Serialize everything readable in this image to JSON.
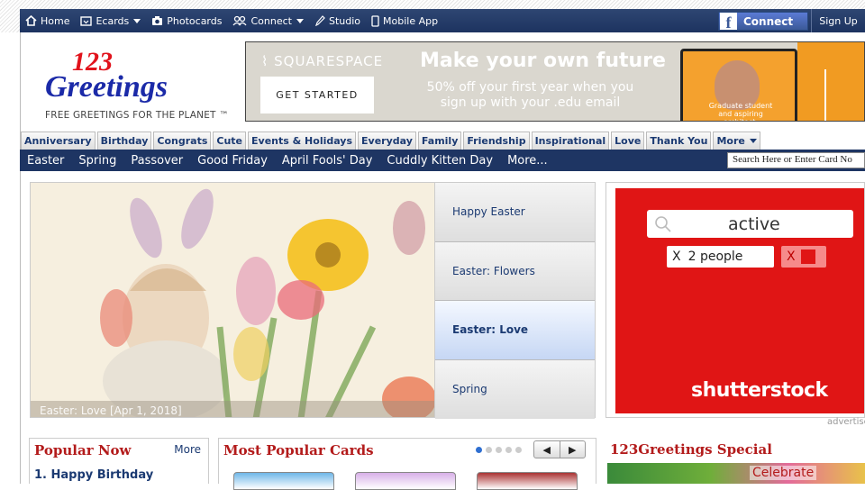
{
  "topnav": {
    "items": [
      {
        "label": "Home",
        "icon": "home-icon"
      },
      {
        "label": "Ecards",
        "icon": "ecard-icon",
        "dropdown": true
      },
      {
        "label": "Photocards",
        "icon": "camera-icon"
      },
      {
        "label": "Connect",
        "icon": "people-icon",
        "dropdown": true
      },
      {
        "label": "Studio",
        "icon": "pen-icon"
      },
      {
        "label": "Mobile App",
        "icon": "phone-icon"
      }
    ],
    "facebook_label": "Connect",
    "signup_label": "Sign Up"
  },
  "logo": {
    "number": "123",
    "word": "Greetings",
    "tagline": "FREE GREETINGS FOR THE PLANET ™"
  },
  "banner_ad": {
    "brand": "SQUARESPACE",
    "cta": "GET STARTED",
    "headline": "Make your own future",
    "subtext": "50% off your first year when you sign up with your .edu email",
    "laptop_text": "Graduate student and aspiring architect."
  },
  "categories": [
    "Anniversary",
    "Birthday",
    "Congrats",
    "Cute",
    "Events & Holidays",
    "Everyday",
    "Family",
    "Friendship",
    "Inspirational",
    "Love",
    "Thank You",
    "More"
  ],
  "subnav": [
    "Easter",
    "Spring",
    "Passover",
    "Good Friday",
    "April Fools' Day",
    "Cuddly Kitten Day",
    "More..."
  ],
  "search": {
    "placeholder": "Search Here or Enter Card No"
  },
  "slider": {
    "caption": "Easter: Love [Apr 1, 2018]",
    "items": [
      "Happy Easter",
      "Easter: Flowers",
      "Easter: Love",
      "Spring"
    ],
    "active_index": 2
  },
  "side_ad": {
    "search_term": "active",
    "filter1": "2 people",
    "filter1_x": "X",
    "filter2_x": "X",
    "brand": "shutterstock"
  },
  "advertisement_label": "advertise",
  "popular_now": {
    "title": "Popular Now",
    "more": "More",
    "first_item": "1. Happy Birthday"
  },
  "most_popular": {
    "title": "Most Popular Cards",
    "prev": "◀",
    "next": "▶",
    "dot_count": 5,
    "active_dot": 0
  },
  "special": {
    "title": "123Greetings Special",
    "banner_text": "Celebrate"
  },
  "colors": {
    "nav": "#1e3563",
    "brand_red": "#e1131c",
    "brand_blue": "#1b2aa8",
    "link": "#1b3a72",
    "title_red": "#b31b1b",
    "shutterstock_red": "#e01515"
  }
}
